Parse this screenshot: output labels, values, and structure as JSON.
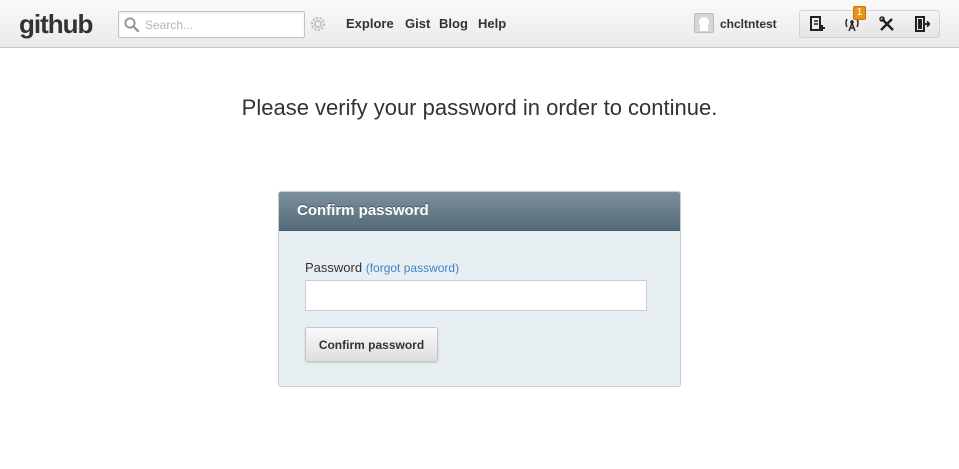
{
  "header": {
    "logo_text": "github",
    "search": {
      "placeholder": "Search...",
      "value": ""
    },
    "nav": [
      "Explore",
      "Gist",
      "Blog",
      "Help"
    ],
    "username": "chcltntest",
    "notification_count": "1",
    "tools": {
      "new_repo_icon": "new-repo-icon",
      "notifications_icon": "broadcast-icon",
      "settings_icon": "tools-icon",
      "logout_icon": "logout-icon"
    }
  },
  "main": {
    "message": "Please verify your password in order to continue.",
    "box": {
      "title": "Confirm password",
      "password_label": "Password",
      "forgot_link": "(forgot password)",
      "password_value": "",
      "button_label": "Confirm password"
    }
  },
  "colors": {
    "link": "#4183c4",
    "box_header": "#566b79",
    "box_bg": "#e8eff3",
    "badge": "#ea9215"
  }
}
